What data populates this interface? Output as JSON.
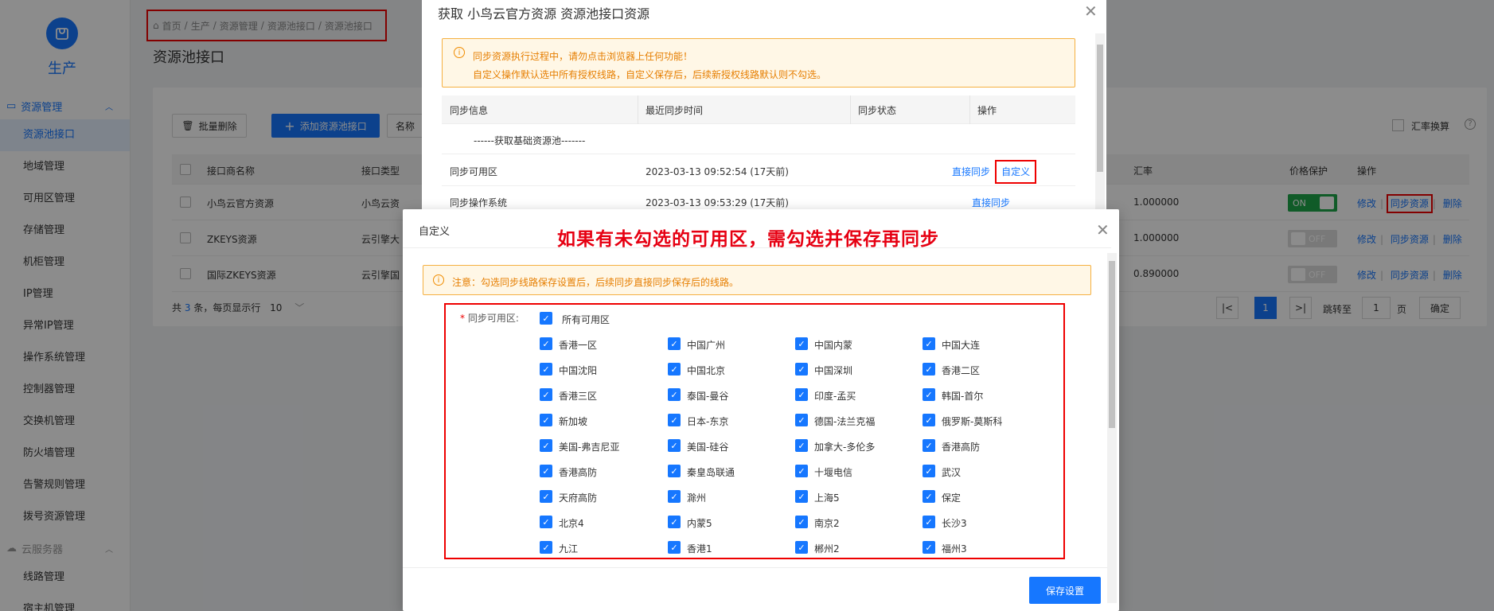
{
  "sidebar": {
    "app_name": "生产",
    "groups": [
      {
        "label": "资源管理",
        "items": [
          "资源池接口",
          "地域管理",
          "可用区管理",
          "存储管理",
          "机柜管理",
          "IP管理",
          "异常IP管理",
          "操作系统管理",
          "控制器管理",
          "交换机管理",
          "防火墙管理",
          "告警规则管理",
          "拨号资源管理"
        ]
      },
      {
        "label": "云服务器",
        "items": [
          "线路管理",
          "宿主机管理"
        ]
      }
    ],
    "active_item": "资源池接口"
  },
  "breadcrumb": [
    "首页",
    "生产",
    "资源管理",
    "资源池接口",
    "资源池接口"
  ],
  "page": {
    "title": "资源池接口",
    "toolbar": {
      "batch_delete": "批量删除",
      "add": "添加资源池接口",
      "name_filter": "名称"
    },
    "exchange_label": "汇率换算",
    "table": {
      "headers": [
        "接口商名称",
        "接口类型",
        "汇率",
        "价格保护",
        "操作"
      ],
      "rows": [
        {
          "name": "小鸟云官方资源",
          "type": "小鸟云资",
          "rate": "1.000000",
          "protect": "ON"
        },
        {
          "name": "ZKEYS资源",
          "type": "云引擎大",
          "rate": "1.000000",
          "protect": "OFF"
        },
        {
          "name": "国际ZKEYS资源",
          "type": "云引擎国",
          "rate": "0.890000",
          "protect": "OFF"
        }
      ],
      "actions": [
        "修改",
        "同步资源",
        "删除"
      ]
    },
    "footer": {
      "prefix": "共",
      "count": "3",
      "suffix": "条，每页显示行",
      "page_size": "10"
    },
    "pager": {
      "current": "1",
      "jump_label": "跳转至",
      "jump_value": "1",
      "page_unit": "页",
      "confirm": "确定"
    }
  },
  "dialog_sync": {
    "title": "获取 小鸟云官方资源 资源池接口资源",
    "alert_lines": [
      "同步资源执行过程中，请勿点击浏览器上任何功能！",
      "自定义操作默认选中所有授权线路，自定义保存后，后续新授权线路默认则不勾选。"
    ],
    "headers": [
      "同步信息",
      "最近同步时间",
      "同步状态",
      "操作"
    ],
    "group_row": "------获取基础资源池-------",
    "rows": [
      {
        "info": "同步可用区",
        "time": "2023-03-13 09:52:54 (17天前)",
        "actions": [
          "直接同步",
          "自定义"
        ]
      },
      {
        "info": "同步操作系统",
        "time": "2023-03-13 09:53:29 (17天前)",
        "actions": [
          "直接同步"
        ]
      }
    ]
  },
  "dialog_custom": {
    "title": "自定义",
    "annotation": "如果有未勾选的可用区，需勾选并保存再同步",
    "alert": "注意：勾选同步线路保存设置后，后续同步直接同步保存后的线路。",
    "field_label": "同步可用区:",
    "all_label": "所有可用区",
    "zones": [
      "香港一区",
      "中国广州",
      "中国内蒙",
      "中国大连",
      "中国沈阳",
      "中国北京",
      "中国深圳",
      "香港二区",
      "香港三区",
      "泰国-曼谷",
      "印度-孟买",
      "韩国-首尔",
      "新加坡",
      "日本-东京",
      "德国-法兰克福",
      "俄罗斯-莫斯科",
      "美国-弗吉尼亚",
      "美国-硅谷",
      "加拿大-多伦多",
      "香港高防",
      "香港高防",
      "秦皇岛联通",
      "十堰电信",
      "武汉",
      "天府高防",
      "滁州",
      "上海5",
      "保定",
      "北京4",
      "内蒙5",
      "南京2",
      "长沙3",
      "九江",
      "香港1",
      "郴州2",
      "福州3"
    ],
    "save": "保存设置"
  },
  "colors": {
    "primary": "#1677ff",
    "annotation": "#e60012",
    "warn": "#e67e00",
    "on": "#1ea64a"
  }
}
